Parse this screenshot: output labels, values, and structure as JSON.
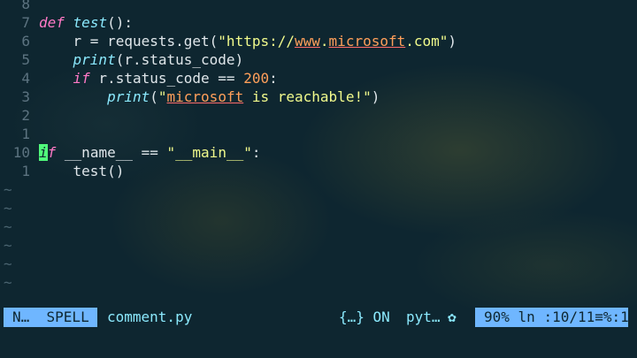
{
  "editor": {
    "lines": [
      {
        "num": "8",
        "tokens": []
      },
      {
        "num": "7",
        "tokens": [
          {
            "t": "def",
            "c": "kw"
          },
          {
            "t": " ",
            "c": "plain"
          },
          {
            "t": "test",
            "c": "fn"
          },
          {
            "t": "():",
            "c": "plain"
          }
        ]
      },
      {
        "num": "6",
        "tokens": [
          {
            "t": "    r = requests.get(",
            "c": "plain"
          },
          {
            "t": "\"https://",
            "c": "str"
          },
          {
            "t": "www",
            "c": "spell"
          },
          {
            "t": ".",
            "c": "str"
          },
          {
            "t": "microsoft",
            "c": "spell"
          },
          {
            "t": ".com\"",
            "c": "str"
          },
          {
            "t": ")",
            "c": "plain"
          }
        ]
      },
      {
        "num": "5",
        "tokens": [
          {
            "t": "    ",
            "c": "plain"
          },
          {
            "t": "print",
            "c": "fn"
          },
          {
            "t": "(r.status_code)",
            "c": "plain"
          }
        ]
      },
      {
        "num": "4",
        "tokens": [
          {
            "t": "    ",
            "c": "plain"
          },
          {
            "t": "if",
            "c": "kw"
          },
          {
            "t": " r.status_code == ",
            "c": "plain"
          },
          {
            "t": "200",
            "c": "num"
          },
          {
            "t": ":",
            "c": "plain"
          }
        ]
      },
      {
        "num": "3",
        "tokens": [
          {
            "t": "        ",
            "c": "plain"
          },
          {
            "t": "print",
            "c": "fn"
          },
          {
            "t": "(",
            "c": "plain"
          },
          {
            "t": "\"",
            "c": "str"
          },
          {
            "t": "microsoft",
            "c": "spell"
          },
          {
            "t": " is reachable!\"",
            "c": "str"
          },
          {
            "t": ")",
            "c": "plain"
          }
        ]
      },
      {
        "num": "2",
        "tokens": []
      },
      {
        "num": "1",
        "tokens": []
      },
      {
        "num": "10",
        "tokens": [
          {
            "t": "i",
            "c": "kw cursor"
          },
          {
            "t": "f",
            "c": "kw"
          },
          {
            "t": " __name__ == ",
            "c": "plain"
          },
          {
            "t": "\"__main__\"",
            "c": "str"
          },
          {
            "t": ":",
            "c": "plain"
          }
        ]
      },
      {
        "num": "1",
        "tokens": [
          {
            "t": "    test()",
            "c": "plain"
          }
        ]
      }
    ],
    "empty_marker": "~",
    "empty_count": 6
  },
  "statusline": {
    "mode": "N…",
    "spell": "SPELL",
    "filename": "comment.py",
    "fold": "{…}",
    "fold_state": "ON",
    "filetype": "pyt…",
    "filetype_icon": "",
    "percent": "90%",
    "position": "ln :10/11≡%:1"
  }
}
